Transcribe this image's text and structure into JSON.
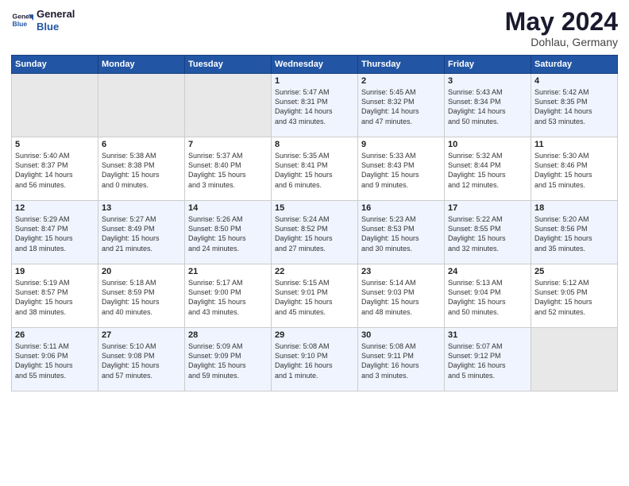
{
  "header": {
    "logo_line1": "General",
    "logo_line2": "Blue",
    "title": "May 2024",
    "subtitle": "Dohlau, Germany"
  },
  "weekdays": [
    "Sunday",
    "Monday",
    "Tuesday",
    "Wednesday",
    "Thursday",
    "Friday",
    "Saturday"
  ],
  "weeks": [
    [
      {
        "day": "",
        "content": ""
      },
      {
        "day": "",
        "content": ""
      },
      {
        "day": "",
        "content": ""
      },
      {
        "day": "1",
        "content": "Sunrise: 5:47 AM\nSunset: 8:31 PM\nDaylight: 14 hours\nand 43 minutes."
      },
      {
        "day": "2",
        "content": "Sunrise: 5:45 AM\nSunset: 8:32 PM\nDaylight: 14 hours\nand 47 minutes."
      },
      {
        "day": "3",
        "content": "Sunrise: 5:43 AM\nSunset: 8:34 PM\nDaylight: 14 hours\nand 50 minutes."
      },
      {
        "day": "4",
        "content": "Sunrise: 5:42 AM\nSunset: 8:35 PM\nDaylight: 14 hours\nand 53 minutes."
      }
    ],
    [
      {
        "day": "5",
        "content": "Sunrise: 5:40 AM\nSunset: 8:37 PM\nDaylight: 14 hours\nand 56 minutes."
      },
      {
        "day": "6",
        "content": "Sunrise: 5:38 AM\nSunset: 8:38 PM\nDaylight: 15 hours\nand 0 minutes."
      },
      {
        "day": "7",
        "content": "Sunrise: 5:37 AM\nSunset: 8:40 PM\nDaylight: 15 hours\nand 3 minutes."
      },
      {
        "day": "8",
        "content": "Sunrise: 5:35 AM\nSunset: 8:41 PM\nDaylight: 15 hours\nand 6 minutes."
      },
      {
        "day": "9",
        "content": "Sunrise: 5:33 AM\nSunset: 8:43 PM\nDaylight: 15 hours\nand 9 minutes."
      },
      {
        "day": "10",
        "content": "Sunrise: 5:32 AM\nSunset: 8:44 PM\nDaylight: 15 hours\nand 12 minutes."
      },
      {
        "day": "11",
        "content": "Sunrise: 5:30 AM\nSunset: 8:46 PM\nDaylight: 15 hours\nand 15 minutes."
      }
    ],
    [
      {
        "day": "12",
        "content": "Sunrise: 5:29 AM\nSunset: 8:47 PM\nDaylight: 15 hours\nand 18 minutes."
      },
      {
        "day": "13",
        "content": "Sunrise: 5:27 AM\nSunset: 8:49 PM\nDaylight: 15 hours\nand 21 minutes."
      },
      {
        "day": "14",
        "content": "Sunrise: 5:26 AM\nSunset: 8:50 PM\nDaylight: 15 hours\nand 24 minutes."
      },
      {
        "day": "15",
        "content": "Sunrise: 5:24 AM\nSunset: 8:52 PM\nDaylight: 15 hours\nand 27 minutes."
      },
      {
        "day": "16",
        "content": "Sunrise: 5:23 AM\nSunset: 8:53 PM\nDaylight: 15 hours\nand 30 minutes."
      },
      {
        "day": "17",
        "content": "Sunrise: 5:22 AM\nSunset: 8:55 PM\nDaylight: 15 hours\nand 32 minutes."
      },
      {
        "day": "18",
        "content": "Sunrise: 5:20 AM\nSunset: 8:56 PM\nDaylight: 15 hours\nand 35 minutes."
      }
    ],
    [
      {
        "day": "19",
        "content": "Sunrise: 5:19 AM\nSunset: 8:57 PM\nDaylight: 15 hours\nand 38 minutes."
      },
      {
        "day": "20",
        "content": "Sunrise: 5:18 AM\nSunset: 8:59 PM\nDaylight: 15 hours\nand 40 minutes."
      },
      {
        "day": "21",
        "content": "Sunrise: 5:17 AM\nSunset: 9:00 PM\nDaylight: 15 hours\nand 43 minutes."
      },
      {
        "day": "22",
        "content": "Sunrise: 5:15 AM\nSunset: 9:01 PM\nDaylight: 15 hours\nand 45 minutes."
      },
      {
        "day": "23",
        "content": "Sunrise: 5:14 AM\nSunset: 9:03 PM\nDaylight: 15 hours\nand 48 minutes."
      },
      {
        "day": "24",
        "content": "Sunrise: 5:13 AM\nSunset: 9:04 PM\nDaylight: 15 hours\nand 50 minutes."
      },
      {
        "day": "25",
        "content": "Sunrise: 5:12 AM\nSunset: 9:05 PM\nDaylight: 15 hours\nand 52 minutes."
      }
    ],
    [
      {
        "day": "26",
        "content": "Sunrise: 5:11 AM\nSunset: 9:06 PM\nDaylight: 15 hours\nand 55 minutes."
      },
      {
        "day": "27",
        "content": "Sunrise: 5:10 AM\nSunset: 9:08 PM\nDaylight: 15 hours\nand 57 minutes."
      },
      {
        "day": "28",
        "content": "Sunrise: 5:09 AM\nSunset: 9:09 PM\nDaylight: 15 hours\nand 59 minutes."
      },
      {
        "day": "29",
        "content": "Sunrise: 5:08 AM\nSunset: 9:10 PM\nDaylight: 16 hours\nand 1 minute."
      },
      {
        "day": "30",
        "content": "Sunrise: 5:08 AM\nSunset: 9:11 PM\nDaylight: 16 hours\nand 3 minutes."
      },
      {
        "day": "31",
        "content": "Sunrise: 5:07 AM\nSunset: 9:12 PM\nDaylight: 16 hours\nand 5 minutes."
      },
      {
        "day": "",
        "content": ""
      }
    ]
  ]
}
